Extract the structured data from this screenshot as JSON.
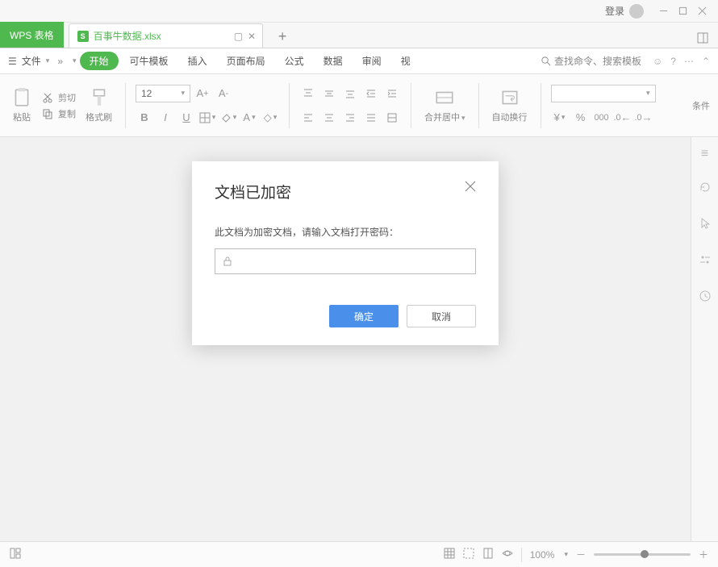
{
  "titlebar": {
    "login_label": "登录"
  },
  "app": {
    "badge": "WPS 表格"
  },
  "tab": {
    "filename": "百事牛数据.xlsx",
    "xls_glyph": "S"
  },
  "menu": {
    "file": "文件",
    "start": "开始",
    "templates": "可牛模板",
    "insert": "插入",
    "page_layout": "页面布局",
    "formula": "公式",
    "data": "数据",
    "review": "审阅",
    "view": "视",
    "search_placeholder": "查找命令、搜索模板"
  },
  "ribbon": {
    "paste": "粘贴",
    "cut": "剪切",
    "copy": "复制",
    "format_painter": "格式刷",
    "font_size": "12",
    "merge_center": "合并居中",
    "wrap_text": "自动换行",
    "side_label": "条件"
  },
  "modal": {
    "title": "文档已加密",
    "message": "此文档为加密文档，请输入文档打开密码：",
    "ok": "确定",
    "cancel": "取消",
    "password_value": ""
  },
  "status": {
    "zoom": "100%"
  }
}
